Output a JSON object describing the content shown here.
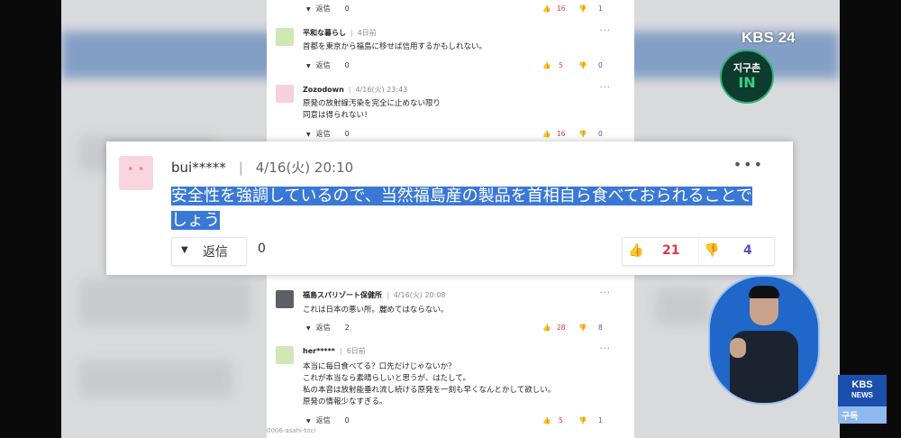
{
  "comments": [
    {
      "reply_label": "返信",
      "reply_count": "0",
      "likes": "16",
      "dislikes": "1"
    },
    {
      "user": "平和な暮らし",
      "date": "4日前",
      "body": "首都を東京から福島に移せば信用するかもしれない。",
      "reply_label": "返信",
      "reply_count": "0",
      "likes": "5",
      "dislikes": "0"
    },
    {
      "user": "Zozodown",
      "date": "4/16(火) 23:43",
      "body": "原発の放射線汚染を完全に止めない限り\n同意は得られない！",
      "reply_label": "返信",
      "reply_count": "0",
      "likes": "16",
      "dislikes": "0"
    },
    {
      "user": "福島スパリゾート保健所",
      "date": "4/16(火) 20:08",
      "body": "これは日本の悪い所。麗めてはならない。",
      "reply_label": "返信",
      "reply_count": "2",
      "likes": "28",
      "dislikes": "8"
    },
    {
      "user": "her*****",
      "date": "6日前",
      "body": "本当に毎日食べてる？口先だけじゃないか？\nこれが本当なら素晴らしいと思うが、はたして。\n私の本音は放射能垂れ流し続ける原発を一刻も早くなんとかして欲しい。\n原発の情報少なすぎる。",
      "reply_label": "返信",
      "reply_count": "0",
      "likes": "5",
      "dislikes": "1"
    }
  ],
  "highlight": {
    "user": "bui*****",
    "date": "4/16(火) 20:10",
    "text": "安全性を強調しているので、当然福島産の製品を首相自ら食べておられることでしょう",
    "reply_label": "返信",
    "reply_count": "0",
    "likes": "21",
    "dislikes": "4"
  },
  "overlay": {
    "channel_logo": "KBS 24",
    "badge_line1": "지구촌",
    "badge_line2": "IN",
    "news_logo_line1": "KBS",
    "news_logo_line2": "NEWS",
    "subscribe": "구독",
    "watermark": "0006-asahi-toci"
  },
  "colors": {
    "like": "#e2374a",
    "dislike": "#5a4fbf",
    "highlight": "#3a78d6",
    "badge_green": "#39d07f"
  },
  "icons": {
    "thumb_up": "thumb-up-icon",
    "thumb_down": "thumb-down-icon",
    "more": "more-icon",
    "reply": "triangle-down-icon"
  }
}
